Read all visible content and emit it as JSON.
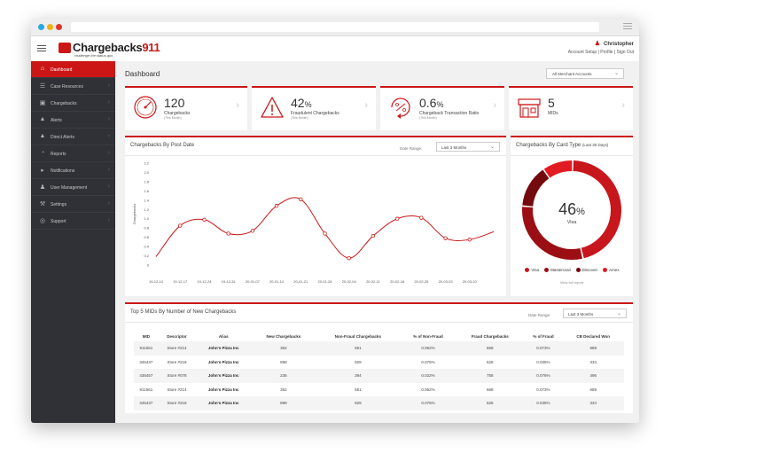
{
  "header": {
    "brand": "Chargebacks",
    "brand_num": "911",
    "tagline": "challenge the status quo",
    "user_name": "Christopher",
    "links": "Account Setup  |  Profile  |  Sign Out"
  },
  "sidebar": {
    "items": [
      {
        "label": "Dashboard"
      },
      {
        "label": "Case Resources"
      },
      {
        "label": "Chargebacks"
      },
      {
        "label": "Alerts"
      },
      {
        "label": "Direct Alerts"
      },
      {
        "label": "Reports"
      },
      {
        "label": "Notifications"
      },
      {
        "label": "User Management"
      },
      {
        "label": "Settings"
      },
      {
        "label": "Support"
      }
    ]
  },
  "main": {
    "title": "Dashboard",
    "merchant_filter": "All Merchant Accounts"
  },
  "kpis": [
    {
      "value": "120",
      "unit": "",
      "label": "Chargebacks",
      "sub": "(This Month)"
    },
    {
      "value": "42",
      "unit": "%",
      "label": "Fraudulent Chargebacks",
      "sub": "(This Month)"
    },
    {
      "value": "0.6",
      "unit": "%",
      "label": "Chargeback Transaction Ratio",
      "sub": "(This Month)"
    },
    {
      "value": "5",
      "unit": "",
      "label": "MIDs",
      "sub": ""
    }
  ],
  "line_card": {
    "title": "Chargebacks By Post Date",
    "range_label": "Date Range:",
    "range_value": "Last 3 Months"
  },
  "donut_card": {
    "title": "Chargebacks By Card Type",
    "title_note": "(Last 30 Days)",
    "center_value": "46",
    "center_unit": "%",
    "center_label": "Visa",
    "view_link": "View full report"
  },
  "table_card": {
    "title": "Top 5 MIDs By Number of New Chargebacks",
    "range_label": "Date Range:",
    "range_value": "Last 3 Months",
    "columns": [
      "MID",
      "Descriptor",
      "Alias",
      "New Chargebacks",
      "Non-Fraud Chargebacks",
      "% of Non-Fraud",
      "Fraud Chargebacks",
      "% of Fraud",
      "CB Declared Won"
    ],
    "rows": [
      [
        "911561",
        "Store #214",
        "John's Pizza Inc",
        "352",
        "551",
        "0.062%",
        "668",
        "0.073%",
        "689"
      ],
      [
        "345437",
        "Store #218",
        "John's Pizza Inc",
        "899",
        "929",
        "0.075%",
        "526",
        "0.035%",
        "334"
      ],
      [
        "436457",
        "Store #078",
        "John's Pizza Inc",
        "236",
        "394",
        "0.022%",
        "758",
        "0.076%",
        "496"
      ],
      [
        "911561",
        "Store #214",
        "John's Pizza Inc",
        "352",
        "551",
        "0.062%",
        "668",
        "0.073%",
        "689"
      ],
      [
        "345437",
        "Store #218",
        "John's Pizza Inc",
        "899",
        "929",
        "0.075%",
        "526",
        "0.035%",
        "334"
      ]
    ]
  },
  "chart_data": [
    {
      "type": "line",
      "title": "Chargebacks By Post Date",
      "ylabel": "Chargebacks",
      "xlabel": "",
      "ylim": [
        0,
        1.2
      ],
      "yticks": [
        "0",
        "0.2",
        "0.4",
        "0.6",
        "0.8",
        "1.0",
        "1.2",
        "1.4",
        "1.6",
        "1.8",
        "2.0",
        "2.2"
      ],
      "yrange": [
        0,
        2.2
      ],
      "x": [
        "19-12-10",
        "19-12-17",
        "19-12-24",
        "19-12-31",
        "20-01-07",
        "20-01-14",
        "20-01-21",
        "20-01-28",
        "20-02-04",
        "20-02-11",
        "20-02-18",
        "20-02-25",
        "20-03-03",
        "20-03-10"
      ],
      "series": [
        {
          "values": [
            0.18,
            0.85,
            0.98,
            0.68,
            0.74,
            1.28,
            1.42,
            0.68,
            0.15,
            0.63,
            1.0,
            1.02,
            0.58,
            0.55,
            0.72
          ]
        }
      ],
      "grid": false,
      "color": "#cc1616"
    },
    {
      "type": "pie",
      "title": "Chargebacks By Card Type (Last 30 Days)",
      "labels": [
        "Visa",
        "Mastercard",
        "Discover",
        "Amex"
      ],
      "values": [
        46,
        30,
        14,
        10
      ],
      "colors": [
        "#c8161d",
        "#9a0e14",
        "#74090e",
        "#e11b22"
      ],
      "legend": "bottom"
    }
  ]
}
